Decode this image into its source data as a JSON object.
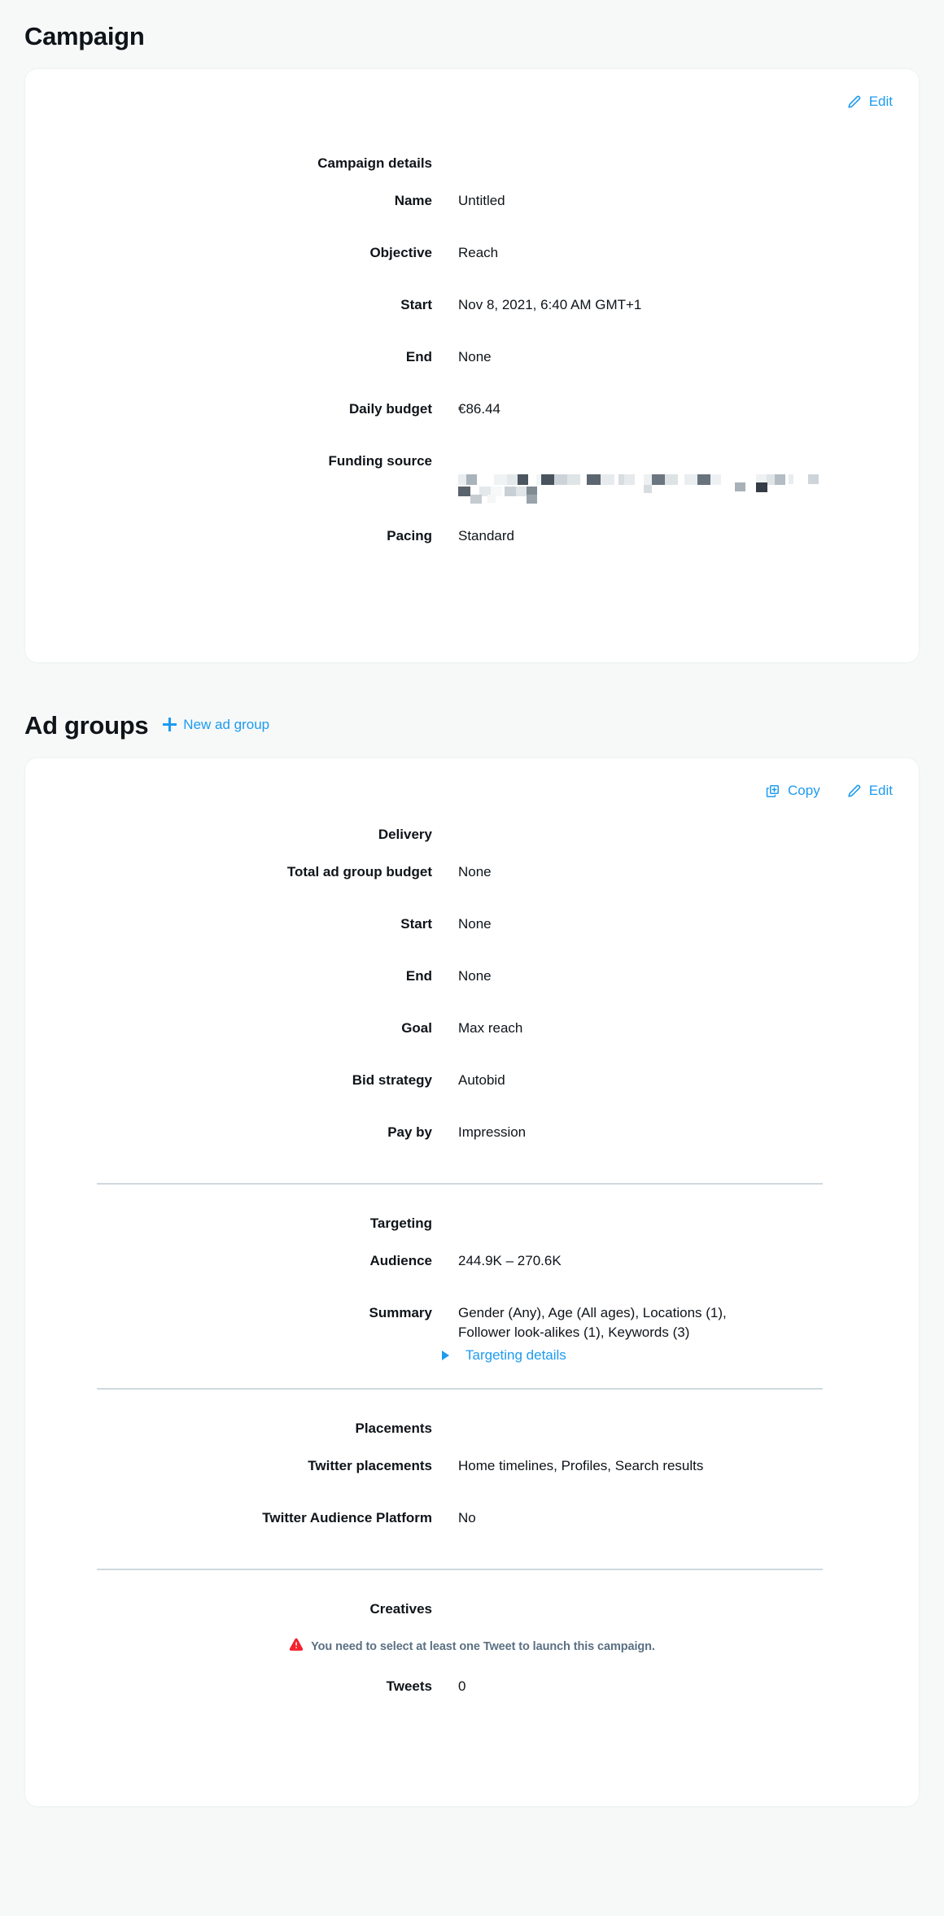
{
  "campaign": {
    "section_title": "Campaign",
    "edit_label": "Edit",
    "details_title": "Campaign details",
    "fields": [
      {
        "label": "Name",
        "value": "Untitled"
      },
      {
        "label": "Objective",
        "value": "Reach"
      },
      {
        "label": "Start",
        "value": "Nov 8, 2021, 6:40 AM GMT+1"
      },
      {
        "label": "End",
        "value": "None"
      },
      {
        "label": "Daily budget",
        "value": "€86.44"
      },
      {
        "label": "Funding source",
        "value": ""
      },
      {
        "label": "Pacing",
        "value": "Standard"
      }
    ],
    "funding_source_redacted": true
  },
  "ad_groups": {
    "section_title": "Ad groups",
    "new_ad_group_label": "New ad group",
    "copy_label": "Copy",
    "edit_label": "Edit",
    "delivery": {
      "title": "Delivery",
      "fields": [
        {
          "label": "Total ad group budget",
          "value": "None"
        },
        {
          "label": "Start",
          "value": "None"
        },
        {
          "label": "End",
          "value": "None"
        },
        {
          "label": "Goal",
          "value": "Max reach"
        },
        {
          "label": "Bid strategy",
          "value": "Autobid"
        },
        {
          "label": "Pay by",
          "value": "Impression"
        }
      ]
    },
    "targeting": {
      "title": "Targeting",
      "fields": [
        {
          "label": "Audience",
          "value": "244.9K – 270.6K"
        },
        {
          "label": "Summary",
          "value": "Gender (Any), Age (All ages), Locations (1),\nFollower look-alikes (1), Keywords (3)"
        }
      ],
      "details_link_label": "Targeting details"
    },
    "placements": {
      "title": "Placements",
      "fields": [
        {
          "label": "Twitter placements",
          "value": "Home timelines, Profiles, Search results"
        },
        {
          "label": "Twitter Audience Platform",
          "value": "No"
        }
      ]
    },
    "creatives": {
      "title": "Creatives",
      "warning": "You need to select at least one Tweet to launch this campaign.",
      "fields": [
        {
          "label": "Tweets",
          "value": "0"
        }
      ]
    }
  },
  "colors": {
    "accent": "#1d9bf0",
    "text": "#0f1419",
    "muted": "#5b7083",
    "danger": "#f4212e",
    "page_bg": "#f7f9f9",
    "card_bg": "#ffffff",
    "divider": "#cfd9de"
  },
  "icons": {
    "edit": "pencil-icon",
    "copy": "duplicate-icon",
    "new": "plus-icon",
    "disclosure": "triangle-right-icon",
    "warning": "alert-triangle-icon"
  }
}
